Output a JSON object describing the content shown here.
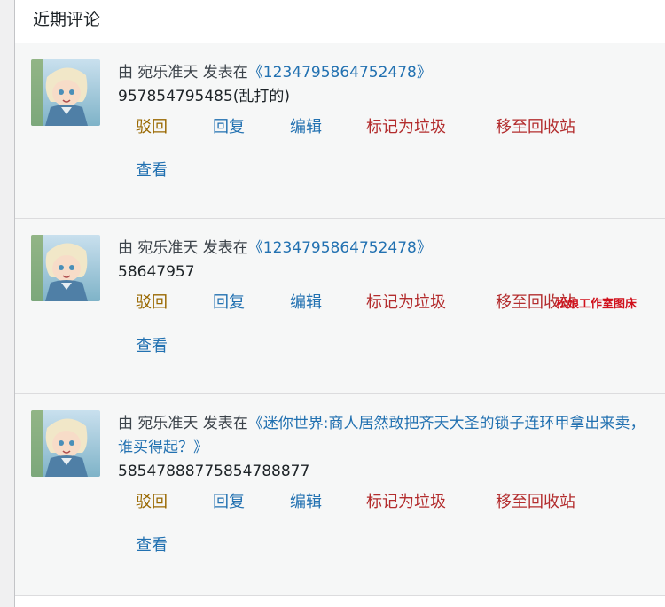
{
  "panel": {
    "title": "近期评论"
  },
  "comments": [
    {
      "prefix": "由 宛乐准天 发表在",
      "post_title": "《1234795864752478》",
      "text": "957854795485(乱打的)"
    },
    {
      "prefix": "由 宛乐准天 发表在",
      "post_title": "《1234795864752478》",
      "text": "58647957"
    },
    {
      "prefix": "由 宛乐准天 发表在",
      "post_title": "《迷你世界:商人居然敢把齐天大圣的锁子连环甲拿出来卖，谁买得起？》",
      "text": "58547888775854788877"
    }
  ],
  "actions": {
    "reject": "驳回",
    "reply": "回复",
    "edit": "编辑",
    "spam": "标记为垃圾",
    "trash": "移至回收站",
    "view": "查看"
  },
  "watermark": "松娘工作室图床",
  "colors": {
    "link": "#2271b1",
    "reject": "#996800",
    "danger": "#b32d2e",
    "row_bg": "#f6f7f7"
  }
}
